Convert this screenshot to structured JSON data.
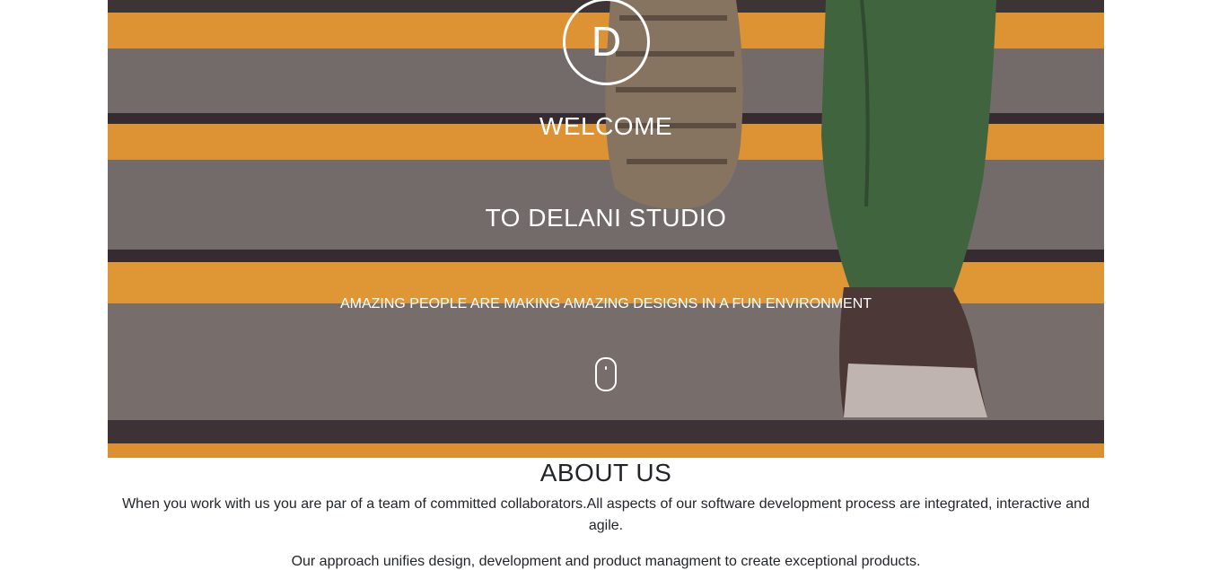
{
  "hero": {
    "logo_letter": "D",
    "welcome": "WELCOME",
    "studio": "TO DELANI STUDIO",
    "tagline": "AMAZING PEOPLE ARE MAKING AMAZING DESIGNS IN A FUN ENVIRONMENT",
    "scroll_icon": "mouse-icon",
    "image": "stairs-sneakers-photo"
  },
  "about": {
    "heading": "ABOUT US",
    "paragraph1": "When you work with us you are par of a team of committed collaborators.All aspects of our software development process are integrated, interactive and agile.",
    "paragraph2": "Our approach unifies design, development and product managment to create exceptional products."
  },
  "colors": {
    "stripe": "#f5a531",
    "stair": "#76736b",
    "text": "#212529"
  }
}
